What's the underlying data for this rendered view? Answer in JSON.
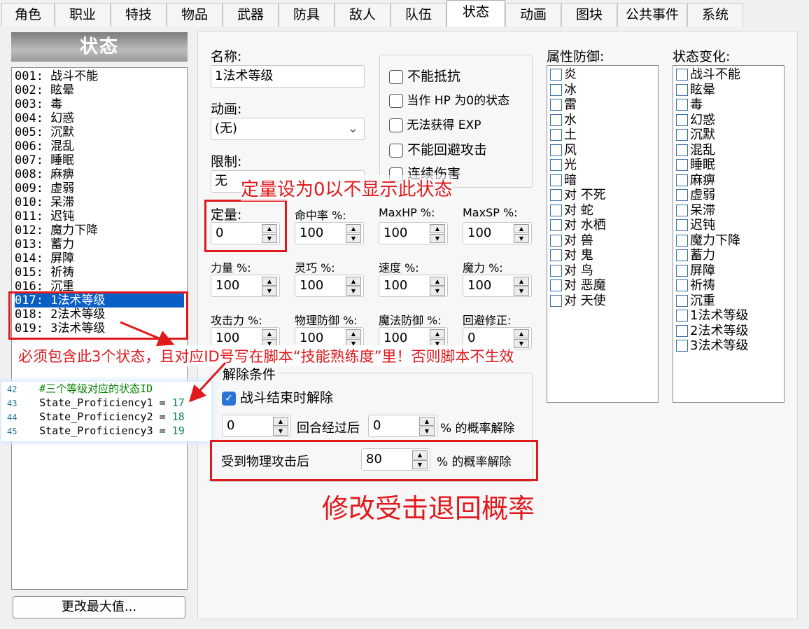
{
  "tabs": [
    "角色",
    "职业",
    "特技",
    "物品",
    "武器",
    "防具",
    "敌人",
    "队伍",
    "状态",
    "动画",
    "图块",
    "公共事件",
    "系统"
  ],
  "active_tab": "状态",
  "list_header": "状态",
  "state_list": [
    "001: 战斗不能",
    "002: 眩晕",
    "003: 毒",
    "004: 幻惑",
    "005: 沉默",
    "006: 混乱",
    "007: 睡眠",
    "008: 麻痹",
    "009: 虚弱",
    "010: 呆滞",
    "011: 迟钝",
    "012: 魔力下降",
    "013: 蓄力",
    "014: 屏障",
    "015: 祈祷",
    "016: 沉重",
    "017: 1法术等级",
    "018: 2法术等级",
    "019: 3法术等级"
  ],
  "selected_state": "017: 1法术等级",
  "change_max_button": "更改最大值...",
  "form": {
    "name_label": "名称:",
    "name_value": "1法术等级",
    "animation_label": "动画:",
    "animation_value": "(无)",
    "restriction_label": "限制:",
    "restriction_value": "无",
    "rating_label": "定量:",
    "rating_value": "0",
    "hit_label": "命中率 %:",
    "hit_value": "100",
    "maxhp_label": "MaxHP %:",
    "maxhp_value": "100",
    "maxsp_label": "MaxSP %:",
    "maxsp_value": "100",
    "str_label": "力量 %:",
    "str_value": "100",
    "dex_label": "灵巧 %:",
    "dex_value": "100",
    "agi_label": "速度 %:",
    "agi_value": "100",
    "int_label": "魔力 %:",
    "int_value": "100",
    "atk_label": "攻击力 %:",
    "atk_value": "100",
    "pdef_label": "物理防御 %:",
    "pdef_value": "100",
    "mdef_label": "魔法防御 %:",
    "mdef_value": "100",
    "eva_label": "回避修正:",
    "eva_value": "0"
  },
  "options": [
    "不能抵抗",
    "当作 HP 为0的状态",
    "无法获得 EXP",
    "不能回避攻击",
    "连续伤害"
  ],
  "release": {
    "group_label": "解除条件",
    "battle_end_label": "战斗结束时解除",
    "turns_value": "0",
    "turns_label": "回合经过后",
    "turns_pct_value": "0",
    "pct_label": "% 的概率解除",
    "phys_label": "受到物理攻击后",
    "phys_value": "80",
    "phys_pct_label": "% 的概率解除"
  },
  "element_label": "属性防御:",
  "elements": [
    "炎",
    "冰",
    "雷",
    "水",
    "土",
    "风",
    "光",
    "暗",
    "对 不死",
    "对 蛇",
    "对 水栖",
    "对 兽",
    "对 鬼",
    "对 鸟",
    "对 恶魔",
    "对 天使"
  ],
  "state_change_label": "状态变化:",
  "state_changes": [
    "战斗不能",
    "眩晕",
    "毒",
    "幻惑",
    "沉默",
    "混乱",
    "睡眠",
    "麻痹",
    "虚弱",
    "呆滞",
    "迟钝",
    "魔力下降",
    "蓄力",
    "屏障",
    "祈祷",
    "沉重",
    "1法术等级",
    "2法术等级",
    "3法术等级"
  ],
  "annotations": {
    "rating_note": "定量设为0以不显示此状态",
    "list_note": "必须包含此3个状态，且对应ID号写在脚本“技能熟练度”里！否则脚本不生效",
    "release_note": "修改受击退回概率"
  },
  "code": {
    "lines": [
      {
        "no": "42",
        "comment": "#三个等级对应的状态ID"
      },
      {
        "no": "43",
        "name": "State_Proficiency1",
        "value": "17"
      },
      {
        "no": "44",
        "name": "State_Proficiency2",
        "value": "18"
      },
      {
        "no": "45",
        "name": "State_Proficiency3",
        "value": "19"
      }
    ]
  },
  "colors": {
    "annotation": "#e0191d",
    "selection": "#0a5fc4",
    "checkbox_on": "#2b74d6"
  }
}
